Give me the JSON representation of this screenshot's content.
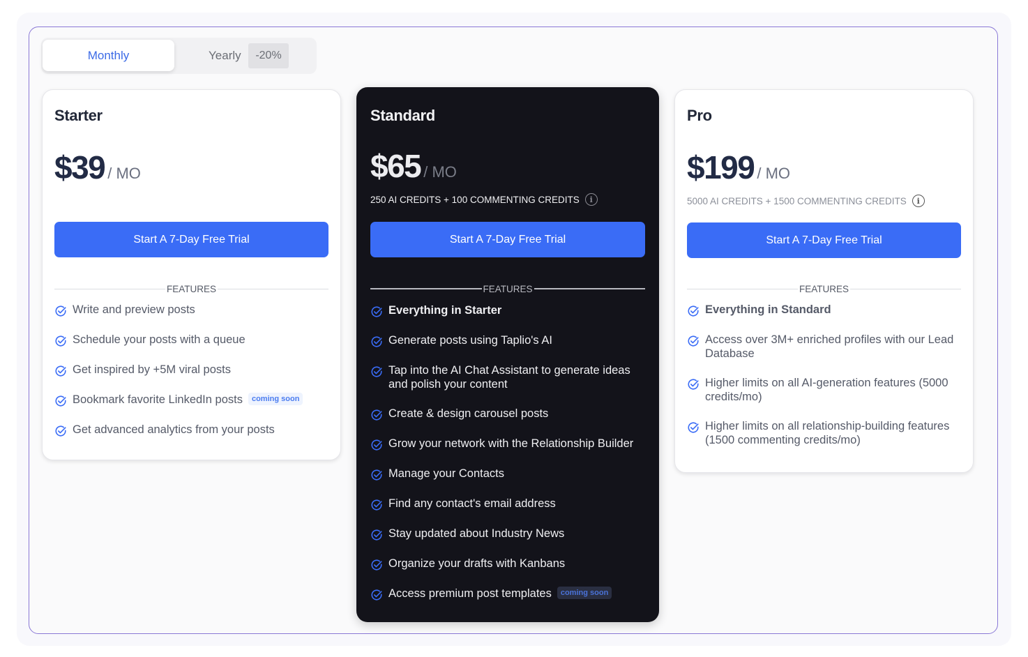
{
  "billing_toggle": {
    "monthly_label": "Monthly",
    "yearly_label": "Yearly",
    "yearly_discount": "-20%",
    "selected": "Monthly"
  },
  "colors": {
    "accent": "#3a6cf6",
    "dark_card": "#13131a",
    "frame_border": "#8a78d6"
  },
  "plans": [
    {
      "name": "Starter",
      "price": "$39",
      "unit": "/ MO",
      "credits": "",
      "cta": "Start A 7-Day Free Trial",
      "features_heading": "FEATURES",
      "features": [
        {
          "text": "Write and preview posts"
        },
        {
          "text": "Schedule your posts with a queue"
        },
        {
          "text": "Get inspired by +5M viral posts"
        },
        {
          "text": "Bookmark favorite LinkedIn posts",
          "badge": "coming soon"
        },
        {
          "text": "Get advanced analytics from your posts"
        }
      ]
    },
    {
      "name": "Standard",
      "price": "$65",
      "unit": "/ MO",
      "credits": "250 AI CREDITS + 100 COMMENTING CREDITS",
      "cta": "Start A 7-Day Free Trial",
      "features_heading": "FEATURES",
      "features": [
        {
          "text": "Everything in Starter",
          "bold": true
        },
        {
          "text": "Generate posts using Taplio's AI"
        },
        {
          "text": "Tap into the AI Chat Assistant to generate ideas and polish your content"
        },
        {
          "text": "Create & design carousel posts"
        },
        {
          "text": "Grow your network with the Relationship Builder"
        },
        {
          "text": "Manage your Contacts"
        },
        {
          "text": "Find any contact's email address"
        },
        {
          "text": "Stay updated about Industry News"
        },
        {
          "text": "Organize your drafts with Kanbans"
        },
        {
          "text": "Access premium post templates",
          "badge": "coming soon"
        }
      ]
    },
    {
      "name": "Pro",
      "price": "$199",
      "unit": "/ MO",
      "credits": "5000 AI CREDITS + 1500 COMMENTING CREDITS",
      "cta": "Start A 7-Day Free Trial",
      "features_heading": "FEATURES",
      "features": [
        {
          "text": "Everything in Standard",
          "bold": true
        },
        {
          "text": "Access over 3M+ enriched profiles with our Lead Database"
        },
        {
          "text": "Higher limits on all AI-generation features (5000 credits/mo)"
        },
        {
          "text": "Higher limits on all relationship-building features (1500 commenting credits/mo)"
        }
      ]
    }
  ]
}
